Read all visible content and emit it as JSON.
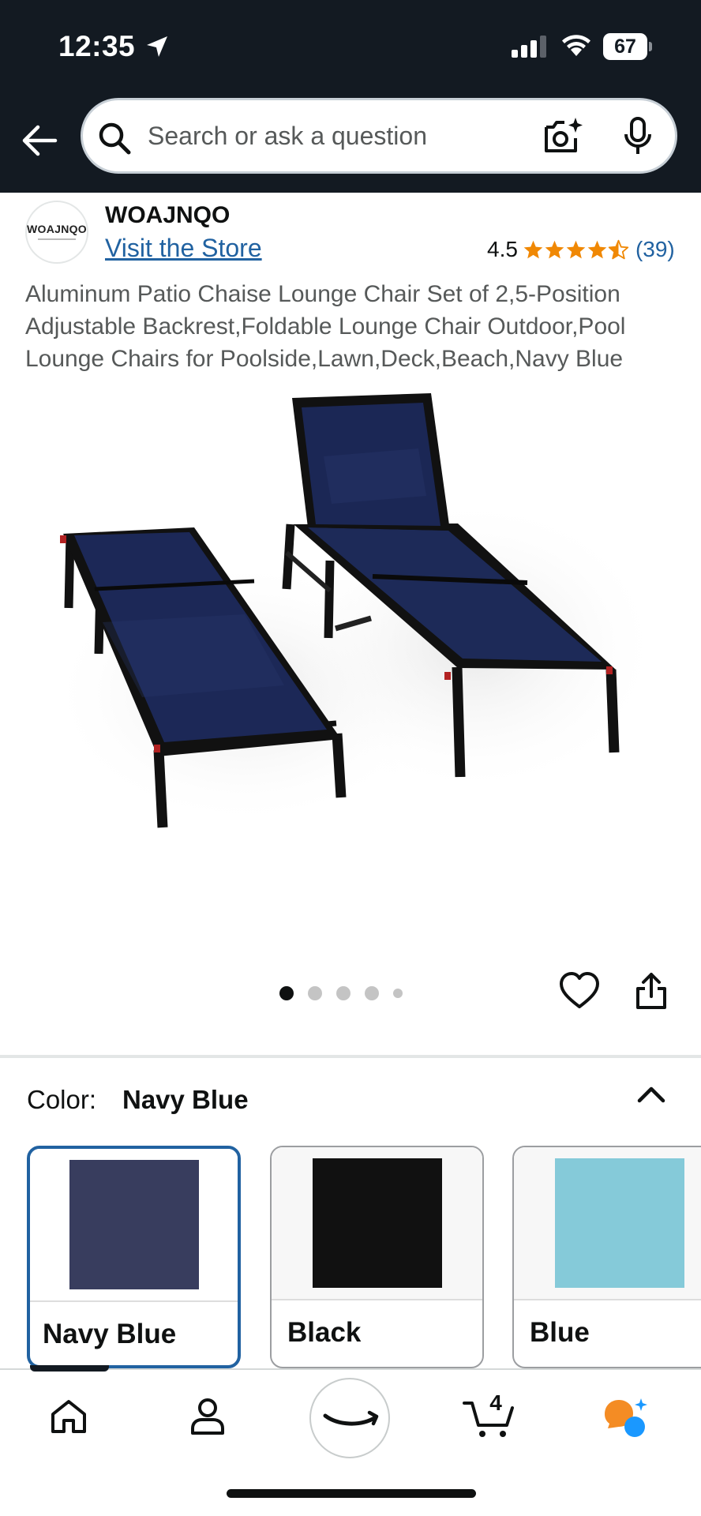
{
  "status_bar": {
    "time": "12:35",
    "battery": "67"
  },
  "search": {
    "placeholder": "Search or ask a question"
  },
  "brand": {
    "logo_text": "WOAJNQO",
    "name": "WOAJNQO",
    "visit_store": "Visit the Store"
  },
  "rating": {
    "value": "4.5",
    "stars": 4.5,
    "count": "(39)",
    "star_color": "#f08804"
  },
  "product": {
    "title": "Aluminum Patio Chaise Lounge Chair Set of 2,5-Position Adjustable Backrest,Foldable Lounge Chair Outdoor,Pool Lounge Chairs for Poolside,Lawn,Deck,Beach,Navy Blue",
    "image_count": 5,
    "image_index": 1
  },
  "color_selector": {
    "label": "Color:",
    "selected": "Navy Blue",
    "options": [
      {
        "name": "Navy Blue",
        "hex": "#383d5e",
        "selected": true
      },
      {
        "name": "Black",
        "hex": "#111111",
        "selected": false
      },
      {
        "name": "Blue",
        "hex": "#85cad9",
        "selected": false
      }
    ]
  },
  "bottom_nav": {
    "items": [
      "home",
      "profile",
      "amazon",
      "cart",
      "rufus"
    ],
    "cart_count": "4"
  },
  "colors": {
    "header_bg": "#131a22",
    "link": "#2162a1",
    "accent_orange": "#f48c24",
    "accent_blue": "#1a98ff"
  }
}
